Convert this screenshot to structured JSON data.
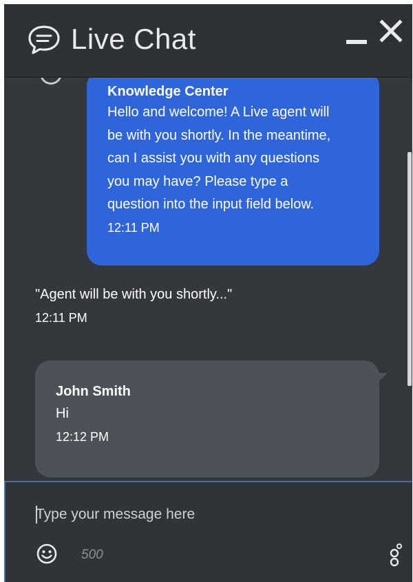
{
  "header": {
    "title": "Live Chat",
    "icons": {
      "chat": "chat-bubble-icon",
      "minimize": "minimize-icon",
      "close": "close-icon"
    }
  },
  "messages": [
    {
      "type": "bot",
      "sender": "Knowledge Center",
      "text_lines": [
        "Hello and welcome! A Live agent will",
        "be with you shortly. In the meantime,",
        "can I assist you with any questions",
        "you may have? Please type a",
        "question into the input field below."
      ],
      "time": "12:11 PM"
    },
    {
      "type": "system",
      "text": "\"Agent will be with you shortly...\"",
      "time": "12:11 PM"
    },
    {
      "type": "user",
      "sender": "John Smith",
      "text": "Hi",
      "time": "12:12 PM"
    }
  ],
  "composer": {
    "placeholder": "Type your message here",
    "char_limit": "500",
    "icons": {
      "emoji": "emoji-icon",
      "brand": "brand-icon"
    }
  },
  "colors": {
    "background": "#34373c",
    "header": "#2e3135",
    "bot_bubble": "#2f65db",
    "user_bubble": "#4d5259",
    "text": "#ffffff",
    "input_border": "#4a6ea8"
  }
}
